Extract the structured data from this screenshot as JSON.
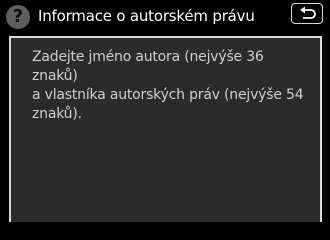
{
  "header": {
    "help_icon_glyph": "?",
    "help_icon_name": "question-mark-icon",
    "title": "Informace o autorském právu",
    "back_icon_name": "return-arrow-icon"
  },
  "content": {
    "message": "Zadejte jméno autora (nejvýše 36 znaků)\na vlastníka autorských práv (nejvýše 54\nznaků)."
  },
  "colors": {
    "background": "#000000",
    "panel": "#2b2b2b",
    "panel_border": "#d9d9d9",
    "title_text": "#ffffff",
    "body_text": "#cfcfcf",
    "help_icon_bg": "#5f5f5f"
  }
}
